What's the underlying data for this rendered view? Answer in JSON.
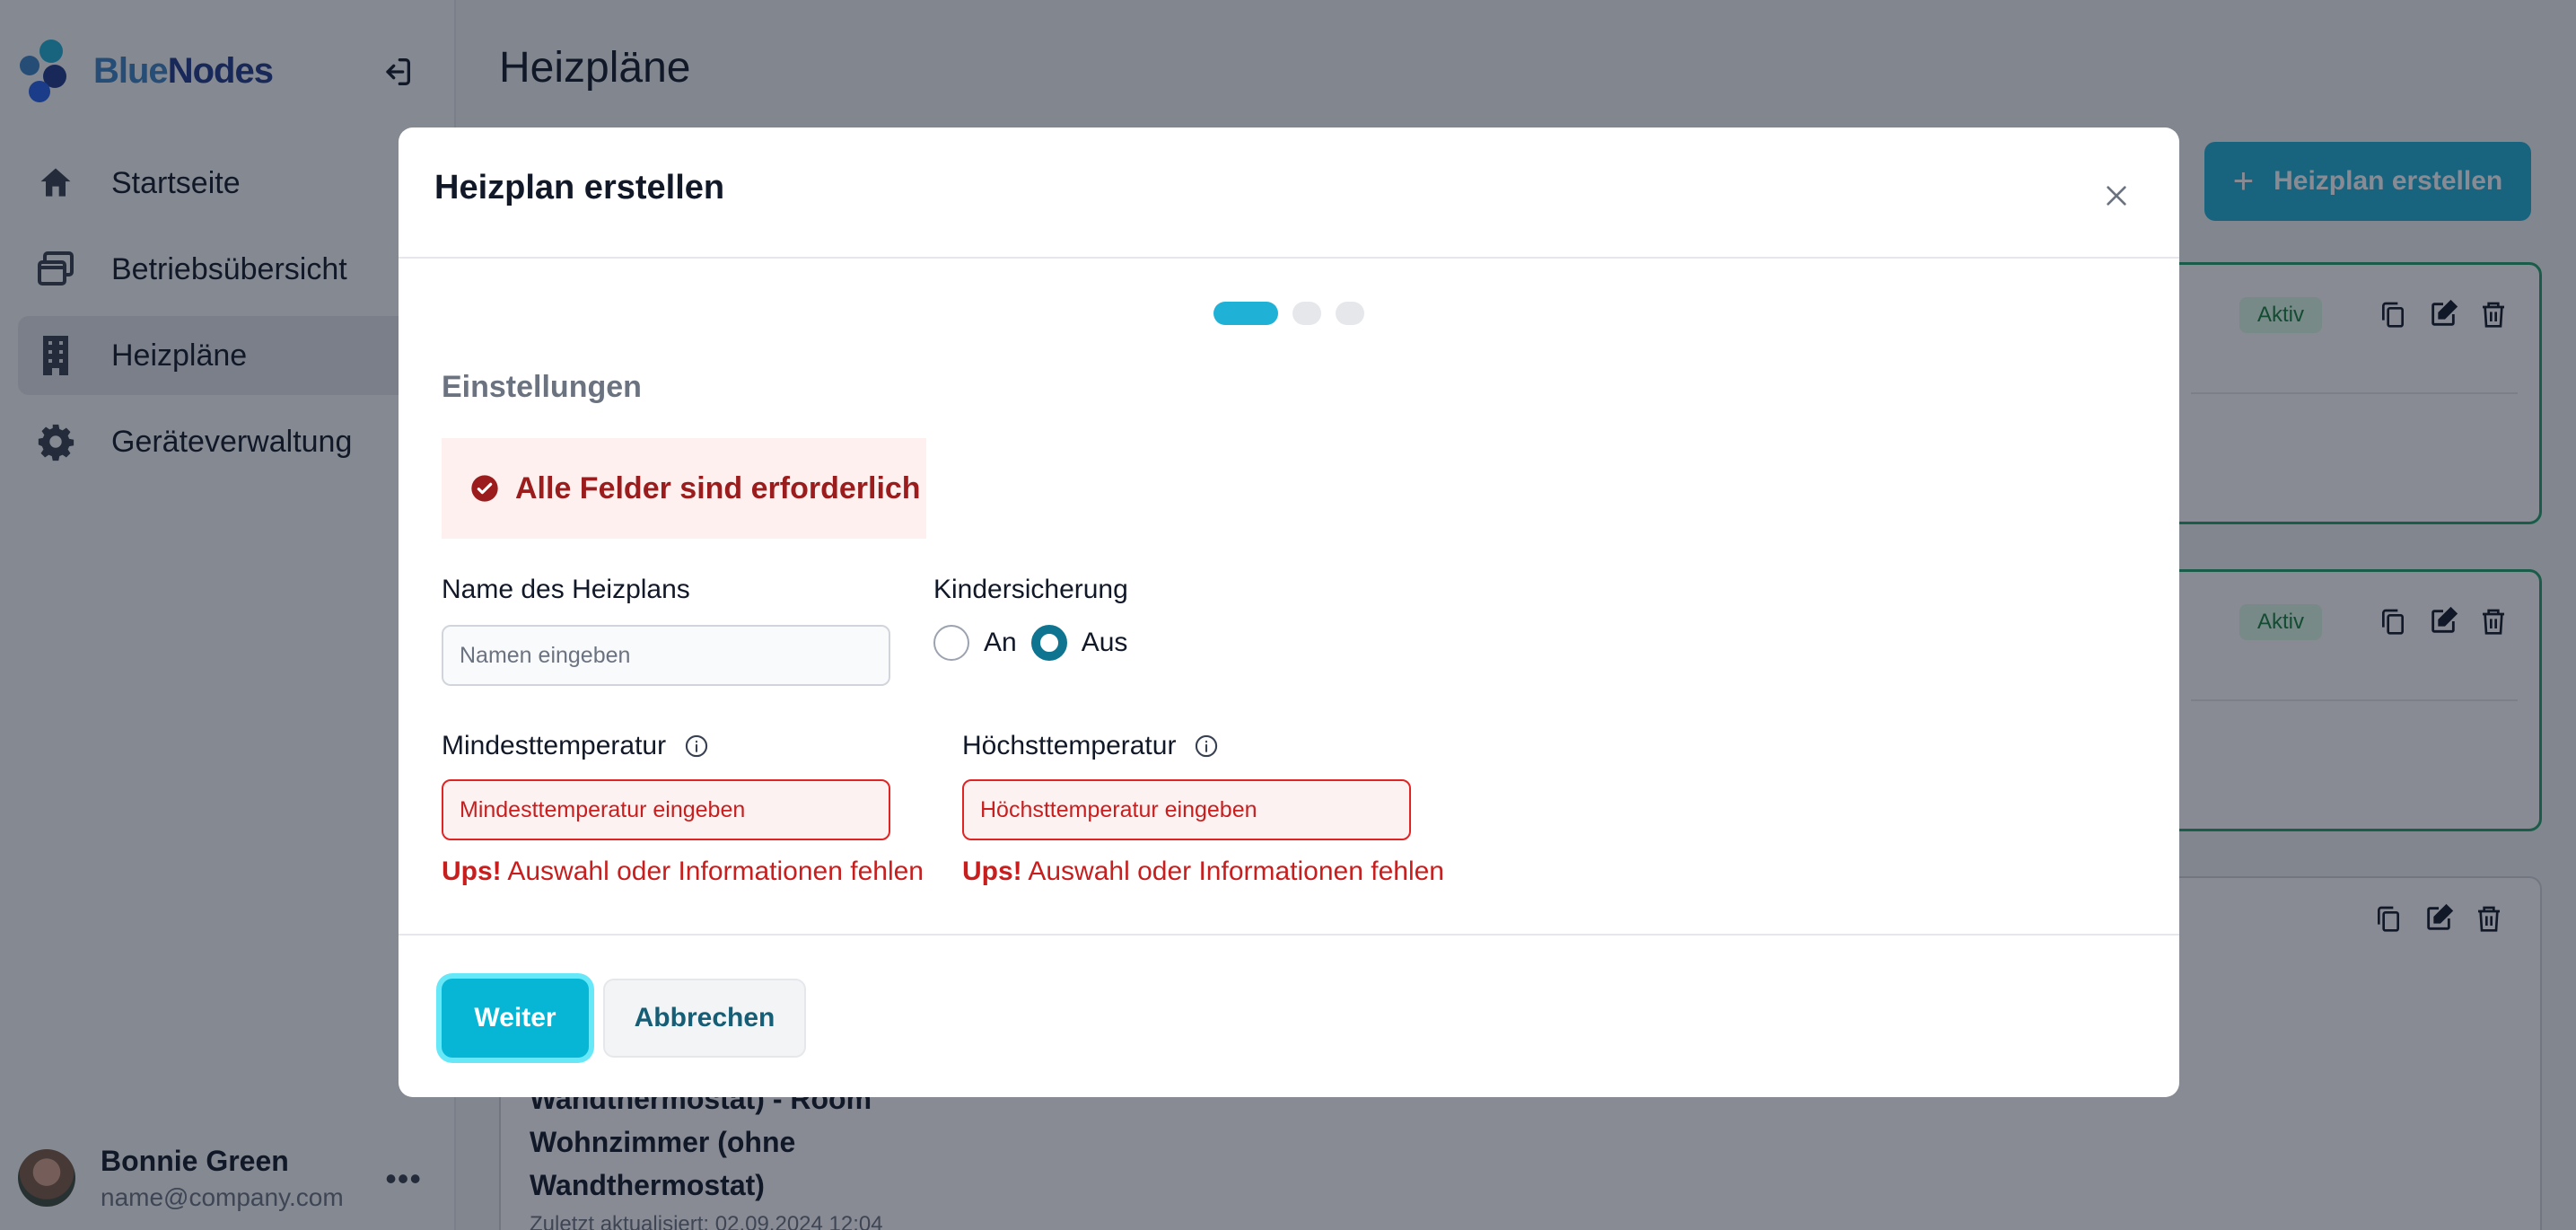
{
  "brand": {
    "name_part1": "Blue",
    "name_part2": "Nodes",
    "color_primary": "#3b82c4",
    "color_dark": "#1e3a8a"
  },
  "sidebar": {
    "items": [
      {
        "label": "Startseite",
        "icon": "home-icon"
      },
      {
        "label": "Betriebsübersicht",
        "icon": "windows-icon"
      },
      {
        "label": "Heizpläne",
        "icon": "building-icon",
        "active": true
      },
      {
        "label": "Geräteverwaltung",
        "icon": "gear-icon"
      }
    ]
  },
  "user": {
    "name": "Bonnie Green",
    "email": "name@company.com",
    "more": "•••"
  },
  "page": {
    "title": "Heizpläne",
    "create_label": "Heizplan erstellen"
  },
  "cards": [
    {
      "badge": "Aktiv"
    },
    {
      "badge": "Aktiv"
    },
    {
      "title_line1": "Wandthermostat) - Room",
      "title_line2": "Wohnzimmer (ohne",
      "title_line3": "Wandthermostat)",
      "updated": "Zuletzt aktualisiert: 02.09.2024 12:04"
    }
  ],
  "modal": {
    "title": "Heizplan erstellen",
    "steps": {
      "total": 3,
      "current": 1
    },
    "section": "Einstellungen",
    "alert": "Alle Felder sind erforderlich",
    "name_label": "Name des Heizplans",
    "name_placeholder": "Namen eingeben",
    "child_lock_label": "Kindersicherung",
    "child_lock_on": "An",
    "child_lock_off": "Aus",
    "child_lock_value": "Aus",
    "min_label": "Mindesttemperatur",
    "min_placeholder": "Mindesttemperatur eingeben",
    "max_label": "Höchsttemperatur",
    "max_placeholder": "Höchsttemperatur eingeben",
    "error_prefix": "Ups!",
    "error_text": "Auswahl oder Informationen fehlen",
    "next_label": "Weiter",
    "cancel_label": "Abbrechen"
  },
  "colors": {
    "accent": "#06b6d4",
    "error": "#c81e1e",
    "active_badge": "#15803d"
  }
}
